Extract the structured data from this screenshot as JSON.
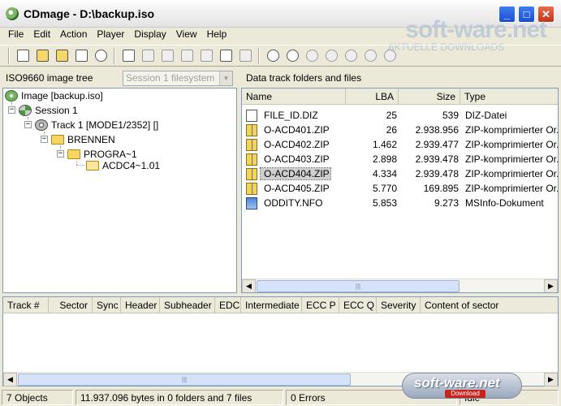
{
  "window": {
    "title": "CDmage - D:\\backup.iso",
    "minimize_glyph": "_",
    "maximize_glyph": "□",
    "close_glyph": "✕"
  },
  "watermark": {
    "brand": "soft-ware.net",
    "tagline": "AKTUELLE DOWNLOADS",
    "badge": "soft-ware.net",
    "badge_sub": "Download"
  },
  "menu": {
    "items": [
      "File",
      "Edit",
      "Action",
      "Player",
      "Display",
      "View",
      "Help"
    ]
  },
  "left_panel": {
    "title": "ISO9660 image tree",
    "filesystem_select": "Session 1 filesystem",
    "tree": {
      "image": "Image [backup.iso]",
      "session": "Session 1",
      "track": "Track  1 [MODE1/2352] []",
      "folder1": "BRENNEN",
      "folder2": "PROGRA~1",
      "folder3": "ACDC4~1.01"
    }
  },
  "right_panel": {
    "title": "Data track folders and files",
    "columns": [
      "Name",
      "LBA",
      "Size",
      "Type"
    ],
    "rows": [
      {
        "name": "FILE_ID.DIZ",
        "lba": "25",
        "size": "539",
        "type": "DIZ-Datei",
        "icon": "text-file-icon"
      },
      {
        "name": "O-ACD401.ZIP",
        "lba": "26",
        "size": "2.938.956",
        "type": "ZIP-komprimierter Or...",
        "icon": "zip-file-icon"
      },
      {
        "name": "O-ACD402.ZIP",
        "lba": "1.462",
        "size": "2.939.477",
        "type": "ZIP-komprimierter Or...",
        "icon": "zip-file-icon"
      },
      {
        "name": "O-ACD403.ZIP",
        "lba": "2.898",
        "size": "2.939.478",
        "type": "ZIP-komprimierter Or...",
        "icon": "zip-file-icon"
      },
      {
        "name": "O-ACD404.ZIP",
        "lba": "4.334",
        "size": "2.939.478",
        "type": "ZIP-komprimierter Or...",
        "icon": "zip-file-icon",
        "selected": true
      },
      {
        "name": "O-ACD405.ZIP",
        "lba": "5.770",
        "size": "169.895",
        "type": "ZIP-komprimierter Or...",
        "icon": "zip-file-icon"
      },
      {
        "name": "ODDITY.NFO",
        "lba": "5.853",
        "size": "9.273",
        "type": "MSInfo-Dokument",
        "icon": "nfo-file-icon"
      }
    ]
  },
  "sector_panel": {
    "columns": [
      "Track #",
      "Sector",
      "Sync",
      "Header",
      "Subheader",
      "EDC",
      "Intermediate",
      "ECC P",
      "ECC Q",
      "Severity",
      "Content of sector"
    ]
  },
  "status": {
    "objects": "7 Objects",
    "bytes": "11.937.096 bytes in 0 folders and 7 files",
    "errors": "0 Errors",
    "state": "Idle"
  }
}
